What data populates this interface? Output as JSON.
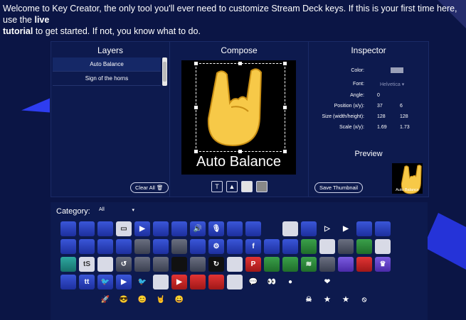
{
  "intro": {
    "part1": "Welcome to Key Creator, the only tool you'll ever need to customize Stream Deck keys. If this is your first time here, use the ",
    "live": "live",
    "tutorial": "tutorial",
    "part2": " to get started. If not, you know what to do."
  },
  "layers": {
    "title": "Layers",
    "items": [
      "Auto Balance",
      "Sign of the horns"
    ],
    "clear_all": "Clear All"
  },
  "compose": {
    "title": "Compose",
    "key_text": "Auto Balance",
    "tools": [
      "text-tool",
      "image-tool",
      "light-background-tool",
      "dark-background-tool"
    ]
  },
  "inspector": {
    "title": "Inspector",
    "color_label": "Color:",
    "font_label": "Font:",
    "font_value": "Helvetica",
    "angle_label": "Angle:",
    "angle_value": "0",
    "position_label": "Position (x/y):",
    "position_x": "37",
    "position_y": "6",
    "size_label": "Size (width/height):",
    "size_w": "128",
    "size_h": "128",
    "scale_label": "Scale (x/y):",
    "scale_x": "1.69",
    "scale_y": "1.73",
    "preview_title": "Preview",
    "save_thumbnail": "Save Thumbnail",
    "preview_text": "Auto Balance"
  },
  "library": {
    "category_label": "Category:",
    "category_value": "All",
    "icons": [
      [
        "elgato-logo",
        "blue"
      ],
      [
        "blank-key",
        "blue"
      ],
      [
        "wrench-icon",
        "blue"
      ],
      [
        "folder-icon",
        "white"
      ],
      [
        "play-icon",
        "blue"
      ],
      [
        "image-icon",
        "blue"
      ],
      [
        "display-icon",
        "blue"
      ],
      [
        "volume-icon",
        "blue"
      ],
      [
        "mic-icon",
        "blue"
      ],
      [
        "plugin-icon",
        "blue"
      ],
      [
        "vr-icon",
        "blue"
      ],
      [
        "streamlabs-icon",
        "none"
      ],
      [
        "folder-light-icon",
        "white"
      ],
      [
        "folder-blue-icon",
        "blue"
      ],
      [
        "play-outline-icon",
        "none"
      ],
      [
        "play-blue-icon",
        "none"
      ],
      [
        "camera-icon",
        "blue"
      ],
      [
        "switch-icon",
        "blue"
      ],
      [
        "none-1",
        "none"
      ],
      [
        "scene-icon",
        "blue"
      ],
      [
        "volume-low-icon",
        "blue"
      ],
      [
        "picture-icon",
        "blue"
      ],
      [
        "mic-blue-icon",
        "blue"
      ],
      [
        "mic-off-icon",
        "gray"
      ],
      [
        "mute-icon",
        "blue"
      ],
      [
        "mute-red-icon",
        "gray"
      ],
      [
        "hexagon-icon",
        "blue"
      ],
      [
        "gear-icon",
        "blue"
      ],
      [
        "wifi-icon",
        "blue"
      ],
      [
        "facebook-icon",
        "blue"
      ],
      [
        "text-key",
        "blue"
      ],
      [
        "text-key-2",
        "blue"
      ],
      [
        "grid-icon",
        "green"
      ],
      [
        "light-key",
        "white"
      ],
      [
        "gray-key",
        "gray"
      ],
      [
        "cam-green-icon",
        "green"
      ],
      [
        "folder-gray-icon",
        "white"
      ],
      [
        "none-2",
        "none"
      ],
      [
        "timer-icon",
        "teal"
      ],
      [
        "ts-icon",
        "white"
      ],
      [
        "window-icon",
        "white"
      ],
      [
        "undo-icon",
        "gray"
      ],
      [
        "display-gray-icon",
        "gray"
      ],
      [
        "image-gray-icon",
        "gray"
      ],
      [
        "music-icon",
        "black"
      ],
      [
        "obs-icon",
        "gray"
      ],
      [
        "refresh-icon",
        "black"
      ],
      [
        "twitch-castle-icon",
        "white"
      ],
      [
        "pinterest-icon",
        "red"
      ],
      [
        "green-key",
        "green"
      ],
      [
        "camera-green-icon",
        "green"
      ],
      [
        "spotify-icon",
        "green"
      ],
      [
        "screen-key",
        "gray"
      ],
      [
        "gauge-icon",
        "purple"
      ],
      [
        "calendar-icon",
        "red"
      ],
      [
        "crown-icon",
        "purple"
      ],
      [
        "none-3",
        "none"
      ],
      [
        "blue-key",
        "blue"
      ],
      [
        "tt-icon",
        "blue"
      ],
      [
        "twitter-icon",
        "blue"
      ],
      [
        "youtube-icon",
        "blue"
      ],
      [
        "twitter-bird-icon",
        "none"
      ],
      [
        "twitter-key-icon",
        "white"
      ],
      [
        "youtube-red-icon",
        "red"
      ],
      [
        "folder-red-icon",
        "red"
      ],
      [
        "play-red-icon",
        "red"
      ],
      [
        "youtube-white-icon",
        "white"
      ],
      [
        "speech-bubble-icon",
        "none"
      ],
      [
        "eyes-icon",
        "none"
      ],
      [
        "bomb-icon",
        "none"
      ],
      [
        "comic-thanks-icon",
        "none"
      ],
      [
        "heart-icon",
        "none"
      ],
      [
        "thanks-icon",
        "none"
      ],
      [
        "thanks-2-icon",
        "none"
      ],
      [
        "follow-icon",
        "none"
      ],
      [
        "none-4",
        "none"
      ],
      [
        "pwned-icon",
        "none"
      ],
      [
        "zap-icon",
        "none"
      ],
      [
        "rocket-icon",
        "none"
      ],
      [
        "cool-emoji-icon",
        "none"
      ],
      [
        "smile-emoji-icon",
        "none"
      ],
      [
        "horns-emoji-icon",
        "none"
      ],
      [
        "grin-emoji-icon",
        "none"
      ],
      [
        "superman-icon",
        "none"
      ],
      [
        "face-icon",
        "none"
      ],
      [
        "new-sub-icon",
        "none"
      ],
      [
        "ouch-icon",
        "none"
      ],
      [
        "splat-icon",
        "none"
      ],
      [
        "nope-icon",
        "none"
      ],
      [
        "skull-icon",
        "none"
      ],
      [
        "star-white-icon",
        "none"
      ],
      [
        "star-red-icon",
        "none"
      ],
      [
        "no-icon",
        "none"
      ],
      [
        "none-5",
        "none"
      ],
      [
        "none-6",
        "none"
      ]
    ]
  }
}
